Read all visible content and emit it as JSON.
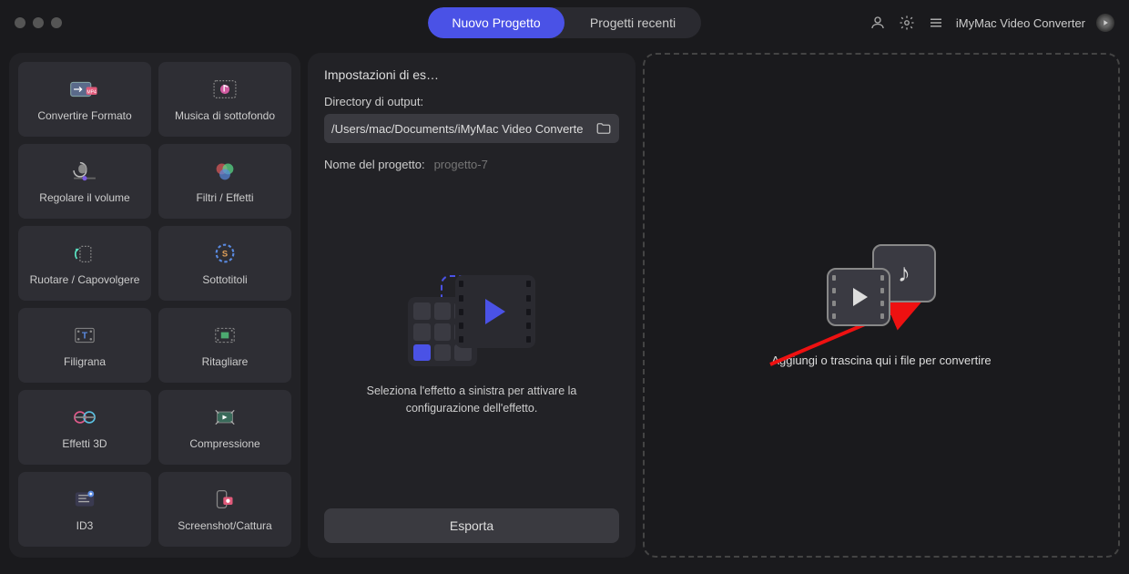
{
  "header": {
    "tabs": {
      "new": "Nuovo Progetto",
      "recent": "Progetti recenti"
    },
    "app_name": "iMyMac Video Converter"
  },
  "tools": [
    {
      "label": "Convertire Formato",
      "icon": "convert"
    },
    {
      "label": "Musica di sottofondo",
      "icon": "music"
    },
    {
      "label": "Regolare il volume",
      "icon": "volume"
    },
    {
      "label": "Filtri / Effetti",
      "icon": "filters"
    },
    {
      "label": "Ruotare / Capovolgere",
      "icon": "rotate"
    },
    {
      "label": "Sottotitoli",
      "icon": "subtitle"
    },
    {
      "label": "Filigrana",
      "icon": "watermark"
    },
    {
      "label": "Ritagliare",
      "icon": "crop"
    },
    {
      "label": "Effetti 3D",
      "icon": "3d"
    },
    {
      "label": "Compressione",
      "icon": "compress"
    },
    {
      "label": "ID3",
      "icon": "id3"
    },
    {
      "label": "Screenshot/Cattura",
      "icon": "screenshot"
    }
  ],
  "settings": {
    "title": "Impostazioni di es…",
    "dir_label": "Directory di output:",
    "dir_value": "/Users/mac/Documents/iMyMac Video Converte",
    "name_label": "Nome del progetto:",
    "name_placeholder": "progetto-7",
    "effect_hint": "Seleziona l'effetto a sinistra per attivare la configurazione dell'effetto.",
    "export": "Esporta"
  },
  "dropzone": {
    "text": "Aggiungi o trascina qui i file per convertire"
  },
  "colors": {
    "accent": "#4a52e6",
    "annotation": "#e11"
  }
}
